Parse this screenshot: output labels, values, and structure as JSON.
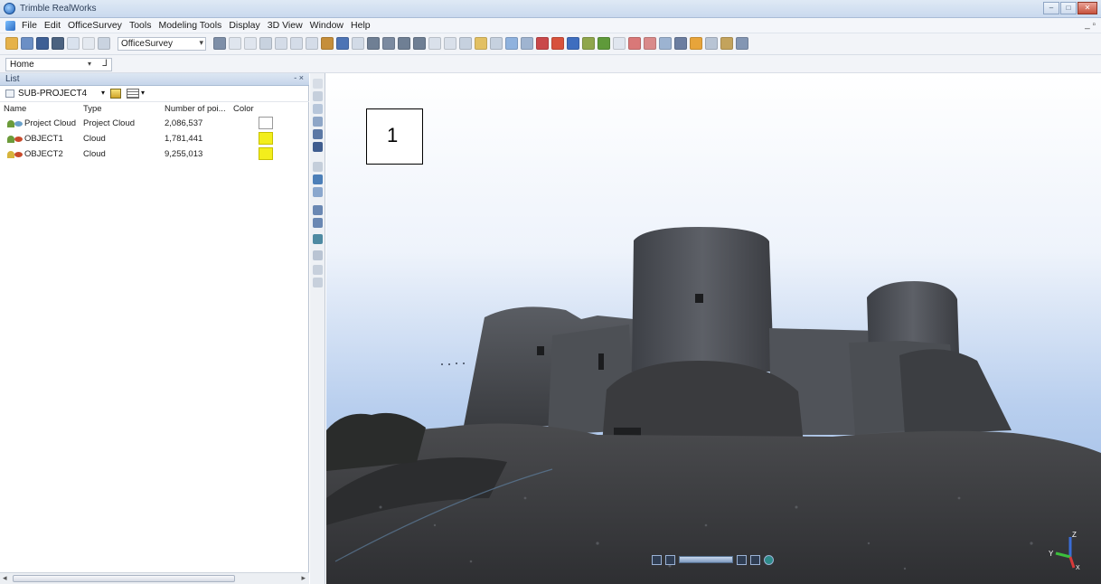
{
  "window": {
    "title": "Trimble RealWorks"
  },
  "menu": {
    "items": [
      "File",
      "Edit",
      "OfficeSurvey",
      "Tools",
      "Modeling Tools",
      "Display",
      "3D View",
      "Window",
      "Help"
    ]
  },
  "toolbar": {
    "mode_combo": "OfficeSurvey"
  },
  "homebar": {
    "combo": "Home"
  },
  "panel": {
    "title": "List",
    "project": "SUB-PROJECT4",
    "columns": [
      "Name",
      "Type",
      "Number of poi...",
      "Color"
    ],
    "rows": [
      {
        "name": "Project Cloud",
        "type": "Project Cloud",
        "points": "2,086,537",
        "color": "#ffffff"
      },
      {
        "name": "OBJECT1",
        "type": "Cloud",
        "points": "1,781,441",
        "color": "#f3ee1c"
      },
      {
        "name": "OBJECT2",
        "type": "Cloud",
        "points": "9,255,013",
        "color": "#f3ee1c"
      }
    ]
  },
  "viewport": {
    "label": "1",
    "axes": {
      "x": "X",
      "y": "Y",
      "z": "Z"
    }
  }
}
